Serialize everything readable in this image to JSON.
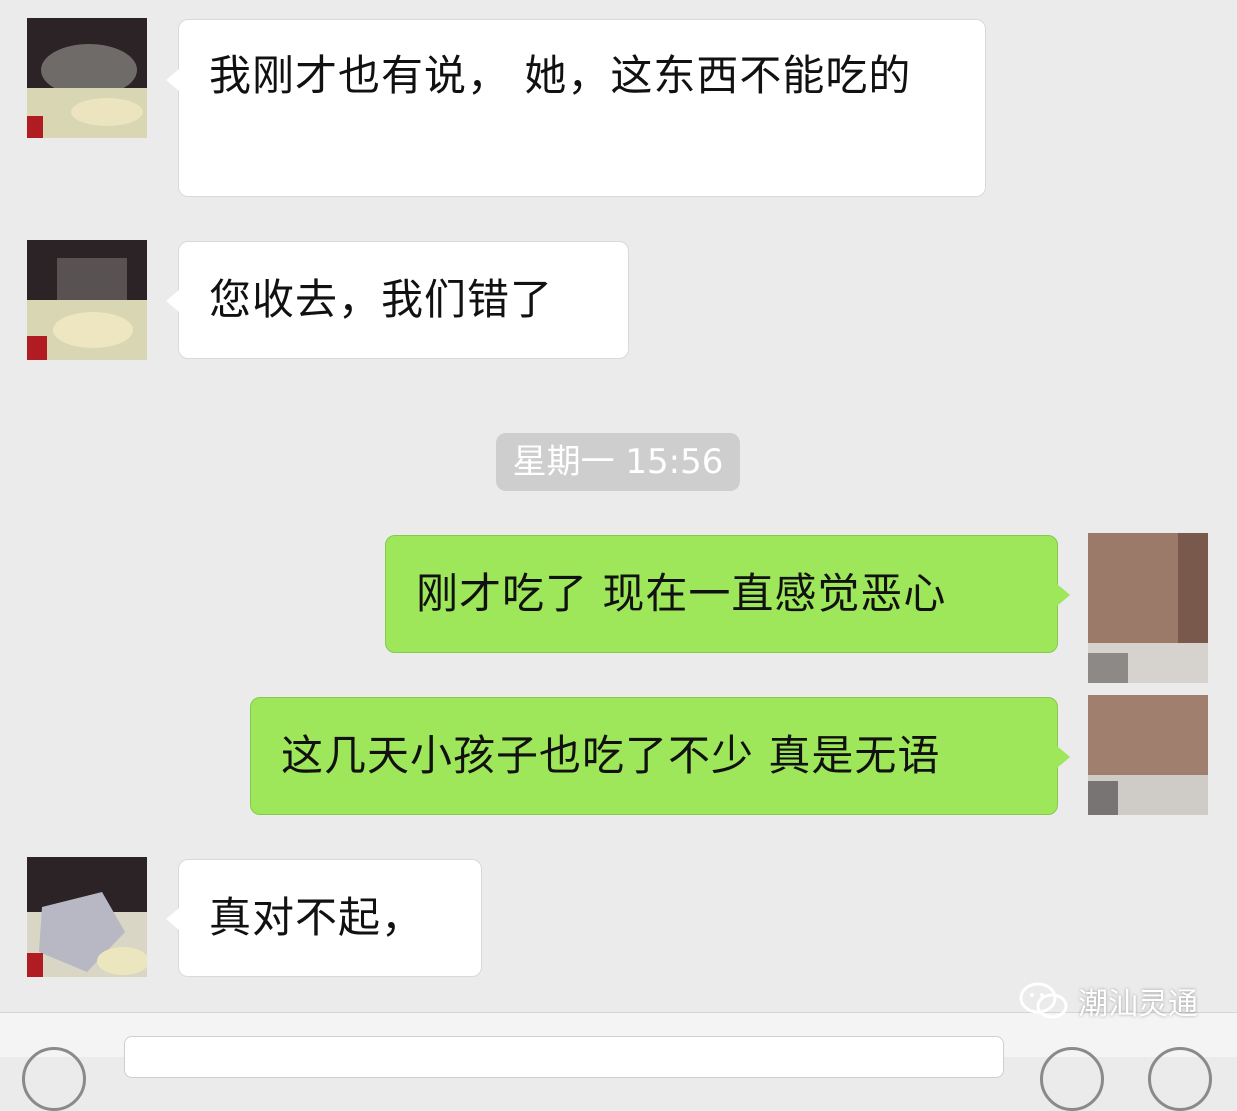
{
  "messages": [
    {
      "side": "in",
      "text": "我刚才也有说， 她，这东西不能吃的"
    },
    {
      "side": "in",
      "text": "您收去，我们错了"
    },
    {
      "side": "out",
      "text": "刚才吃了 现在一直感觉恶心"
    },
    {
      "side": "out",
      "text": "这几天小孩子也吃了不少 真是无语"
    },
    {
      "side": "in",
      "text": "真对不起，"
    }
  ],
  "timestamp": "星期一 15:56",
  "watermark": {
    "text": "潮汕灵通",
    "icon": "wechat-icon"
  },
  "colors": {
    "background": "#ebebeb",
    "incoming_bubble": "#ffffff",
    "outgoing_bubble": "#9ee65a",
    "timestamp_pill": "#cecece"
  }
}
